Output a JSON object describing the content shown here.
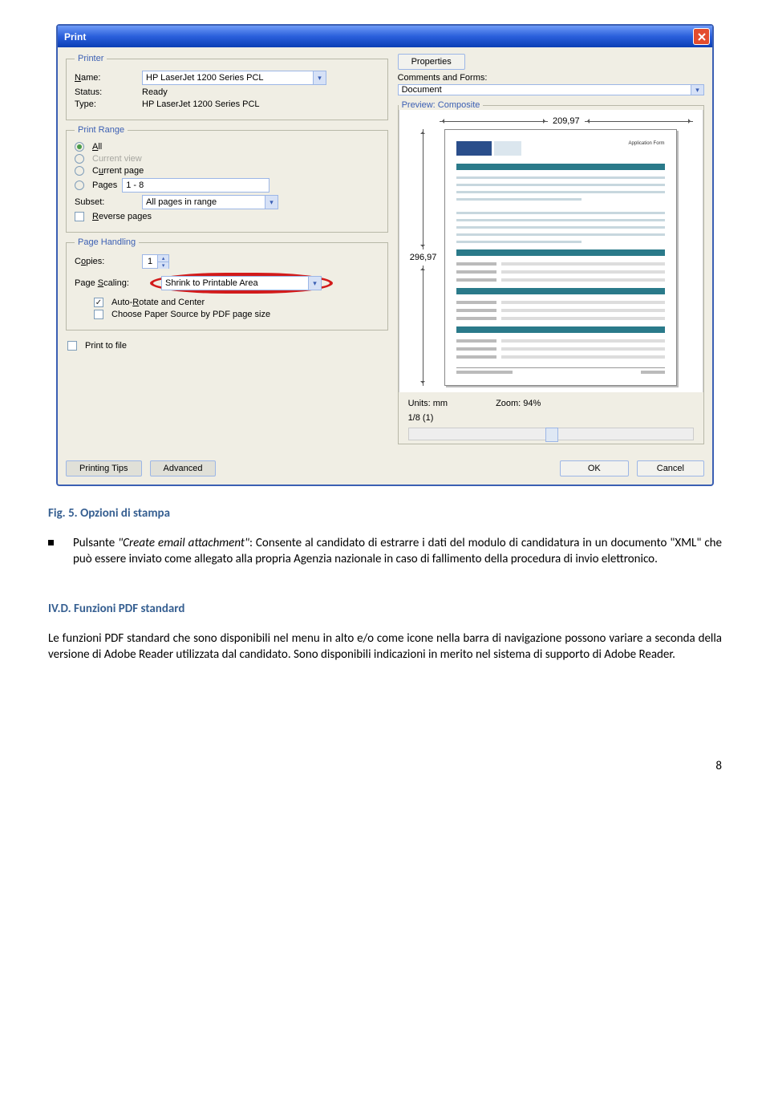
{
  "dialog": {
    "title": "Print",
    "printer_group": "Printer",
    "name_label": "Name:",
    "name_value": "HP LaserJet 1200 Series PCL",
    "status_label": "Status:",
    "status_value": "Ready",
    "type_label": "Type:",
    "type_value": "HP LaserJet 1200 Series PCL",
    "properties_btn": "Properties",
    "comments_label": "Comments and Forms:",
    "comments_value": "Document",
    "print_range_group": "Print Range",
    "all_label": "All",
    "current_view_label": "Current view",
    "current_page_label": "Current page",
    "pages_label": "Pages",
    "pages_value": "1 - 8",
    "subset_label": "Subset:",
    "subset_value": "All pages in range",
    "reverse_pages": "Reverse pages",
    "page_handling_group": "Page Handling",
    "copies_label": "Copies:",
    "copies_value": "1",
    "scaling_label": "Page Scaling:",
    "scaling_value": "Shrink to Printable Area",
    "auto_rotate": "Auto-Rotate and Center",
    "choose_paper": "Choose Paper Source by PDF page size",
    "print_to_file": "Print to file",
    "preview_group": "Preview: Composite",
    "width_mm": "209,97",
    "height_mm": "296,97",
    "units_label": "Units: mm",
    "zoom_label": "Zoom:  94%",
    "page_count": "1/8 (1)",
    "tips_btn": "Printing Tips",
    "advanced_btn": "Advanced",
    "ok_btn": "OK",
    "cancel_btn": "Cancel"
  },
  "doc": {
    "figure_caption": "Fig. 5. Opzioni di stampa",
    "bullet_text": "Pulsante \"Create email attachment\": Consente al candidato di estrarre i dati del modulo di candidatura in un documento \"XML\" che può essere inviato come allegato alla propria Agenzia nazionale in caso di fallimento della procedura di invio elettronico.",
    "bullet_prefix": "Pulsante ",
    "bullet_italic": "\"Create email attachment\"",
    "bullet_rest": ": Consente al candidato di estrarre i dati del modulo di candidatura in un documento \"XML\" che può essere inviato come allegato alla propria Agenzia nazionale in caso di fallimento della procedura di invio elettronico.",
    "heading": "IV.D. Funzioni PDF standard",
    "body": "Le funzioni PDF standard che sono disponibili nel menu in alto e/o come icone nella barra di navigazione possono variare a seconda della versione di Adobe Reader utilizzata dal candidato. Sono disponibili indicazioni in merito nel sistema di supporto di Adobe Reader.",
    "page_number": "8"
  }
}
